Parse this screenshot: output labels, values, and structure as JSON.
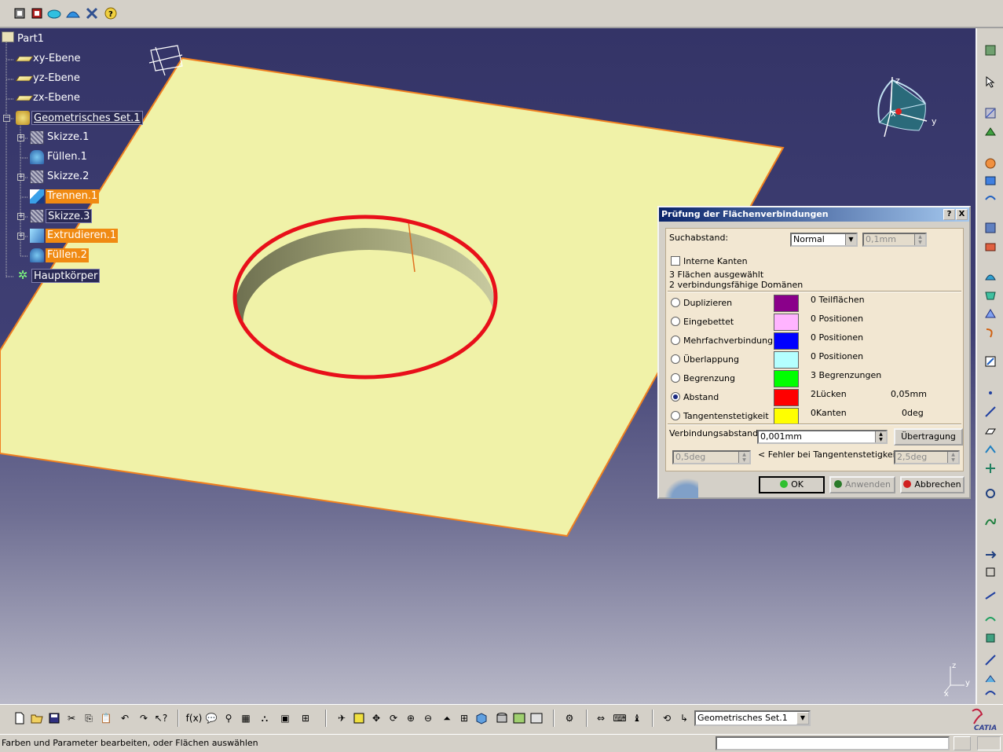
{
  "tree": {
    "root": "Part1",
    "items": [
      {
        "label": "xy-Ebene"
      },
      {
        "label": "yz-Ebene"
      },
      {
        "label": "zx-Ebene"
      },
      {
        "label": "Geometrisches Set.1"
      },
      {
        "label": "Skizze.1"
      },
      {
        "label": "Füllen.1"
      },
      {
        "label": "Skizze.2"
      },
      {
        "label": "Trennen.1"
      },
      {
        "label": "Skizze.3"
      },
      {
        "label": "Extrudieren.1"
      },
      {
        "label": "Füllen.2"
      },
      {
        "label": "Hauptkörper"
      }
    ]
  },
  "compass": {
    "z": "z",
    "y": "y",
    "x": "x"
  },
  "mini_axes": {
    "z": "z",
    "y": "y",
    "x": "x"
  },
  "dialog": {
    "title": "Prüfung der Flächenverbindungen",
    "help_btn": "?",
    "close_btn": "X",
    "search_label": "Suchabstand:",
    "search_mode": "Normal",
    "search_value": "0,1mm",
    "internal_edges": "Interne Kanten",
    "info_1": "3 Flächen ausgewählt",
    "info_2": "2 verbindungsfähige Domänen",
    "rows": [
      {
        "label": "Duplizieren",
        "color": "#8a008a",
        "result": "0 Teilflächen",
        "value": "",
        "checked": false
      },
      {
        "label": "Eingebettet",
        "color": "#ffb4ff",
        "result": "0 Positionen",
        "value": "",
        "checked": false
      },
      {
        "label": "Mehrfachverbindung",
        "color": "#0000ff",
        "result": "0 Positionen",
        "value": "",
        "checked": false
      },
      {
        "label": "Überlappung",
        "color": "#b4ffff",
        "result": "0 Positionen",
        "value": "",
        "checked": false
      },
      {
        "label": "Begrenzung",
        "color": "#00ff00",
        "result": "3 Begrenzungen",
        "value": "",
        "checked": false
      },
      {
        "label": "Abstand",
        "color": "#ff0000",
        "result": "2Lücken",
        "value": "0,05mm",
        "checked": true
      },
      {
        "label": "Tangentenstetigkeit",
        "color": "#ffff00",
        "result": "0Kanten",
        "value": "0deg",
        "checked": false
      }
    ],
    "connect_label": "Verbindungsabstand:",
    "connect_value": "0,001mm",
    "transfer_btn": "Übertragung",
    "tangent_min": "0,5deg",
    "tangent_label": "< Fehler bei Tangentenstetigkeit <",
    "tangent_max": "2,5deg",
    "ok_btn": "OK",
    "apply_btn": "Anwenden",
    "cancel_btn": "Abbrechen"
  },
  "bottom": {
    "current_set": "Geometrisches Set.1"
  },
  "catia_logo": "CATIA",
  "status": {
    "text": "Farben und Parameter bearbeiten, oder Flächen auswählen"
  },
  "colors": {
    "surface": "#f0f2a8",
    "edge_highlight": "#e8101a",
    "viewport_top": "#343467"
  }
}
